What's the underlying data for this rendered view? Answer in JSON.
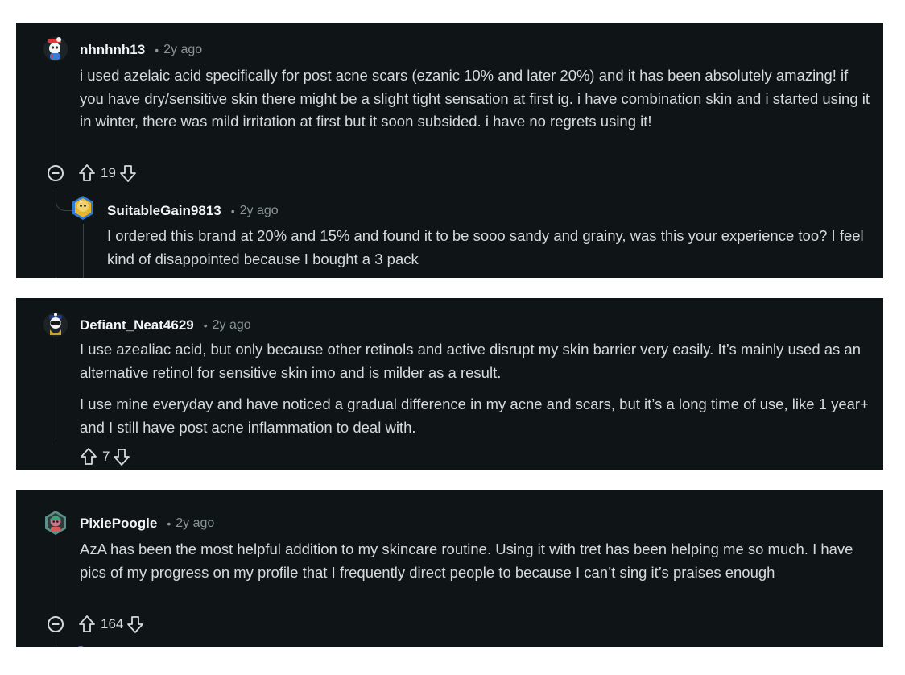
{
  "comments": [
    {
      "username": "nhnhnh13",
      "time": "2y ago",
      "paragraphs": [
        "i used azelaic acid specifically for post acne scars (ezanic 10% and later 20%) and it has been absolutely amazing! if you have dry/sensitive skin there might be a slight tight sensation at first ig. i have combination skin and i started using it in winter, there was mild irritation at first but it soon subsided. i have no regrets using it!"
      ],
      "score": "19",
      "reply": {
        "username": "SuitableGain9813",
        "time": "2y ago",
        "text": "I ordered this brand at 20% and 15% and found it to be sooo sandy and grainy, was this your experience too? I feel kind of disappointed because I bought a 3 pack"
      }
    },
    {
      "username": "Defiant_Neat4629",
      "time": "2y ago",
      "paragraphs": [
        "I use azealiac acid, but only because other retinols and active disrupt my skin barrier very easily. It’s mainly used as an alternative retinol for sensitive skin imo and is milder as a result.",
        "I use mine everyday and have noticed a gradual difference in my acne and scars, but it’s a long time of use, like 1 year+ and I still have post acne inflammation to deal with."
      ],
      "score": "7"
    },
    {
      "username": "PixiePoogle",
      "time": "2y ago",
      "paragraphs": [
        "AzA has been the most helpful addition to my skincare routine. Using it with tret has been helping me so much. I have pics of my progress on my profile that I frequently direct people to because I can’t sing it’s praises enough"
      ],
      "score": "164"
    }
  ],
  "colors": {
    "panel_bg": "#0f1416",
    "text": "#d7dadc",
    "muted": "#8a9599",
    "thread_line": "#3a4347"
  },
  "icons": [
    "collapse-icon",
    "upvote-icon",
    "downvote-icon",
    "avatar"
  ]
}
